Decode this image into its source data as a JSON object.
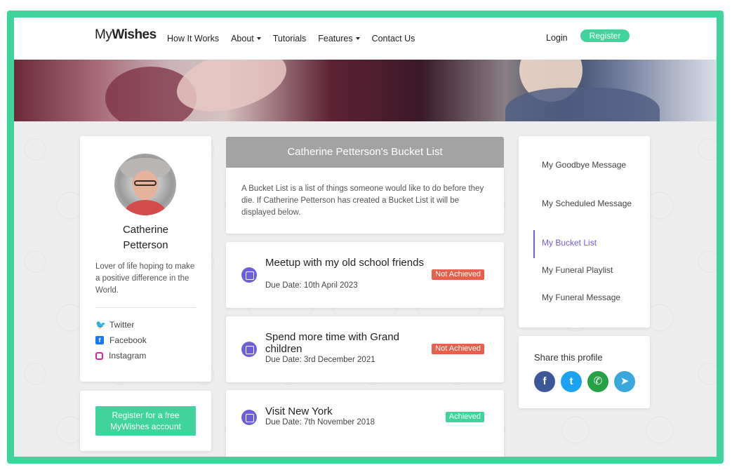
{
  "brand": {
    "logo_light": "My",
    "logo_bold": "Wishes"
  },
  "nav": {
    "links": [
      "How It Works",
      "About",
      "Tutorials",
      "Features",
      "Contact Us"
    ],
    "login": "Login",
    "register": "Register"
  },
  "colors": {
    "accent": "#3fd49b",
    "purple": "#6d5fdb",
    "danger": "#e8604c",
    "header_grey": "#a3a3a3"
  },
  "profile": {
    "name_line1": "Catherine",
    "name_line2": "Petterson",
    "bio": "Lover of life hoping to make a positive difference in the World.",
    "socials": [
      {
        "label": "Twitter",
        "icon": "twitter-icon"
      },
      {
        "label": "Facebook",
        "icon": "facebook-icon"
      },
      {
        "label": "Instagram",
        "icon": "instagram-icon"
      }
    ],
    "register_cta": "Register for a free MyWishes account"
  },
  "bucket": {
    "title": "Catherine Petterson's Bucket List",
    "intro": "A Bucket List is a list of things someone would like to do before they die. If Catherine Petterson has created a Bucket List it will be displayed below.",
    "items": [
      {
        "title": "Meetup with my old school friends",
        "due": "Due Date: 10th April 2023",
        "status": "Not Achieved"
      },
      {
        "title": "Spend more time with Grand children",
        "due": "Due Date: 3rd December 2021",
        "status": "Not Achieved"
      },
      {
        "title": "Visit New York",
        "due": "Due Date: 7th November 2018",
        "status": "Achieved"
      }
    ]
  },
  "menu": {
    "items": [
      "My Goodbye Message",
      "My Scheduled Message",
      "My Bucket List",
      "My Funeral Playlist",
      "My Funeral Message"
    ],
    "active": "My Bucket List"
  },
  "share": {
    "title": "Share this profile",
    "icons": [
      "facebook-icon",
      "twitter-icon",
      "whatsapp-icon",
      "telegram-icon"
    ]
  }
}
